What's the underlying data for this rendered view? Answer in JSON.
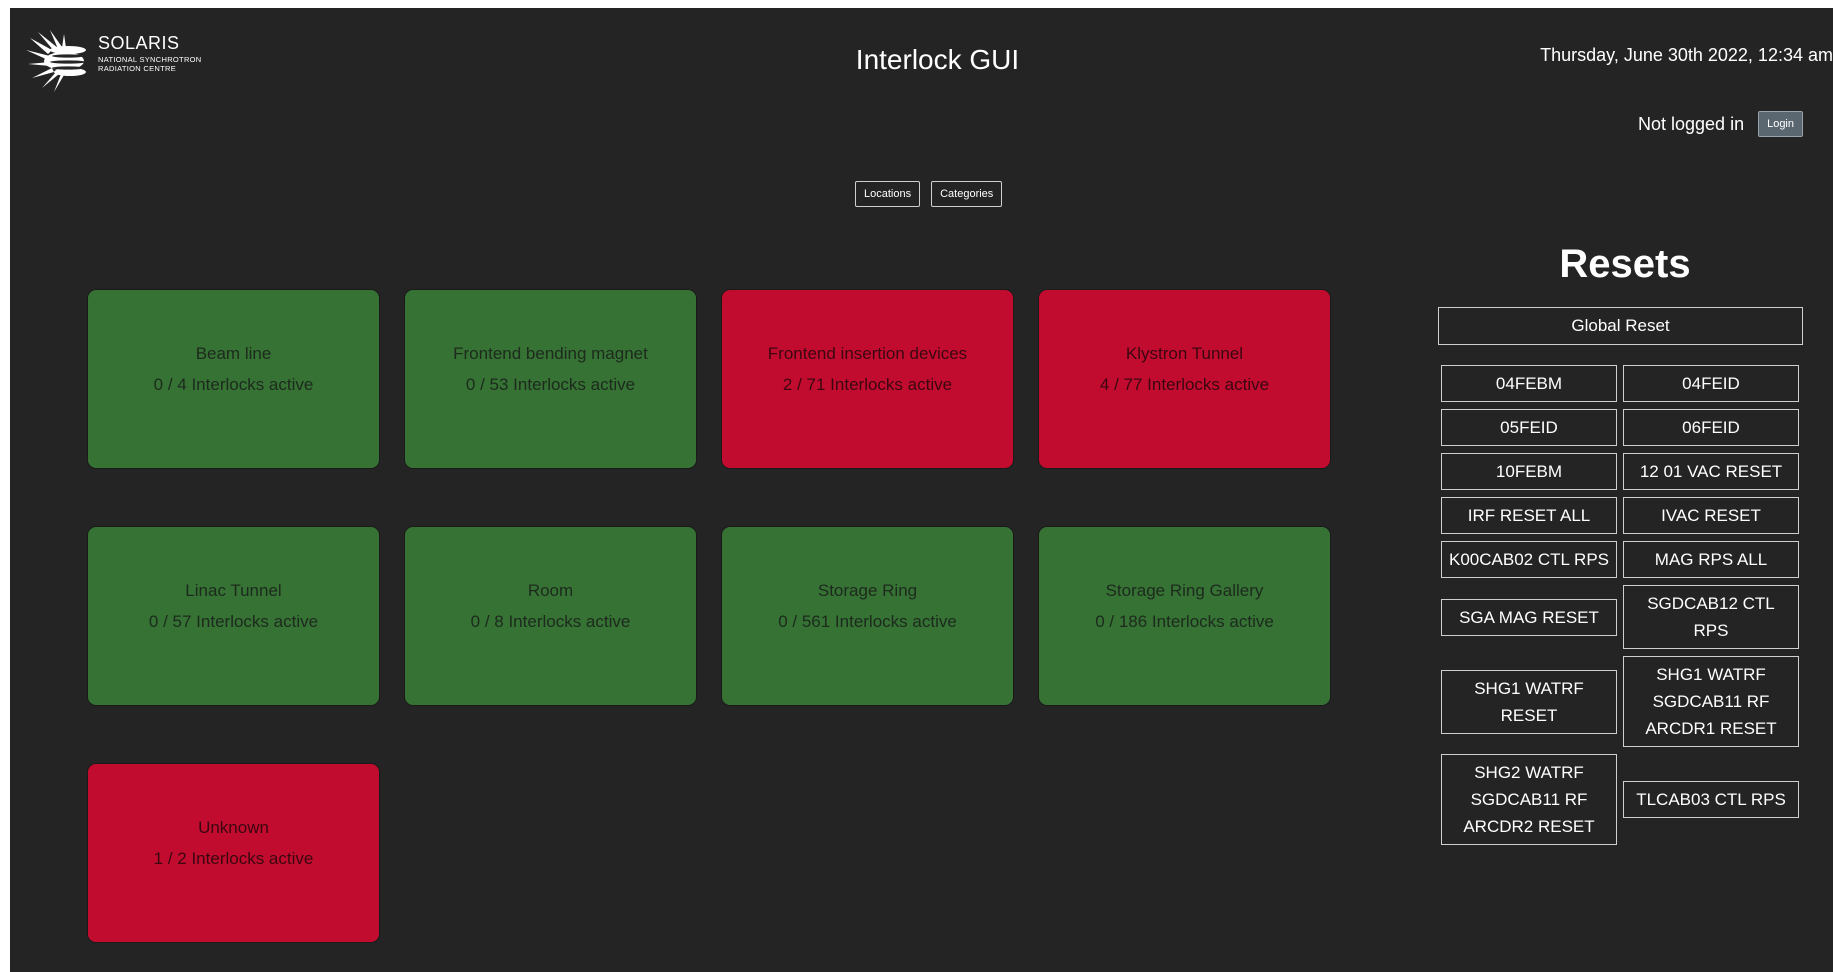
{
  "header": {
    "logo_name": "SOLARIS",
    "logo_sub_line1": "NATIONAL SYNCHROTRON",
    "logo_sub_line2": "RADIATION CENTRE",
    "title": "Interlock GUI",
    "datetime": "Thursday, June 30th 2022, 12:34 am",
    "auth_status": "Not logged in",
    "login_label": "Login"
  },
  "view_toggle": {
    "locations_label": "Locations",
    "categories_label": "Categories"
  },
  "colors": {
    "ok": "#357234",
    "alarm": "#c20c2f",
    "background": "#242424"
  },
  "locations": [
    {
      "name": "Beam line",
      "count": "0 / 4 Interlocks active",
      "status": "ok"
    },
    {
      "name": "Frontend bending magnet",
      "count": "0 / 53 Interlocks active",
      "status": "ok"
    },
    {
      "name": "Frontend insertion devices",
      "count": "2 / 71 Interlocks active",
      "status": "alarm"
    },
    {
      "name": "Klystron Tunnel",
      "count": "4 / 77 Interlocks active",
      "status": "alarm"
    },
    {
      "name": "Linac Tunnel",
      "count": "0 / 57 Interlocks active",
      "status": "ok"
    },
    {
      "name": "Room",
      "count": "0 / 8 Interlocks active",
      "status": "ok"
    },
    {
      "name": "Storage Ring",
      "count": "0 / 561 Interlocks active",
      "status": "ok"
    },
    {
      "name": "Storage Ring Gallery",
      "count": "0 / 186 Interlocks active",
      "status": "ok"
    },
    {
      "name": "Unknown",
      "count": "1 / 2 Interlocks active",
      "status": "alarm"
    }
  ],
  "resets": {
    "title": "Resets",
    "global_label": "Global Reset",
    "buttons": [
      "04FEBM",
      "04FEID",
      "05FEID",
      "06FEID",
      "10FEBM",
      "12 01 VAC RESET",
      "IRF RESET ALL",
      "IVAC RESET",
      "K00CAB02 CTL RPS",
      "MAG RPS ALL",
      "SGA MAG RESET",
      "SGDCAB12 CTL RPS",
      "SHG1 WATRF RESET",
      "SHG1 WATRF SGDCAB11 RF ARCDR1 RESET",
      "SHG2 WATRF SGDCAB11 RF ARCDR2 RESET",
      "TLCAB03 CTL RPS"
    ]
  }
}
